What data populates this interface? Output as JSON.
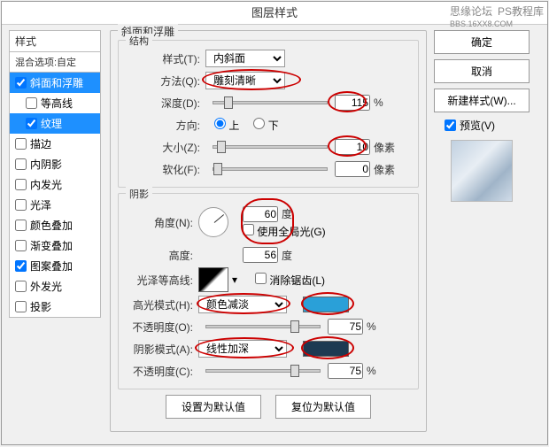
{
  "watermark": {
    "left": "思缘论坛",
    "right": "PS教程库",
    "url": "BBS.16XX8.COM"
  },
  "dialog": {
    "title": "图层样式"
  },
  "left": {
    "header": "样式",
    "sub": "混合选项:自定",
    "items": [
      {
        "label": "斜面和浮雕",
        "checked": true,
        "selected": true
      },
      {
        "label": "等高线",
        "checked": false,
        "sub": true
      },
      {
        "label": "纹理",
        "checked": true,
        "sub": true,
        "selected": true
      },
      {
        "label": "描边",
        "checked": false
      },
      {
        "label": "内阴影",
        "checked": false
      },
      {
        "label": "内发光",
        "checked": false
      },
      {
        "label": "光泽",
        "checked": false
      },
      {
        "label": "颜色叠加",
        "checked": false
      },
      {
        "label": "渐变叠加",
        "checked": false
      },
      {
        "label": "图案叠加",
        "checked": true
      },
      {
        "label": "外发光",
        "checked": false
      },
      {
        "label": "投影",
        "checked": false
      }
    ]
  },
  "bevel": {
    "group_title": "斜面和浮雕",
    "structure_title": "结构",
    "style_label": "样式(T):",
    "style_value": "内斜面",
    "method_label": "方法(Q):",
    "method_value": "雕刻清晰",
    "depth_label": "深度(D):",
    "depth_value": "115",
    "depth_unit": "%",
    "direction_label": "方向:",
    "dir_up": "上",
    "dir_down": "下",
    "size_label": "大小(Z):",
    "size_value": "10",
    "size_unit": "像素",
    "soften_label": "软化(F):",
    "soften_value": "0",
    "soften_unit": "像素"
  },
  "shade": {
    "title": "阴影",
    "angle_label": "角度(N):",
    "angle_value": "60",
    "angle_unit": "度",
    "global_label": "使用全局光(G)",
    "altitude_label": "高度:",
    "altitude_value": "56",
    "altitude_unit": "度",
    "gloss_label": "光泽等高线:",
    "antialias_label": "消除锯齿(L)",
    "hilite_mode_label": "高光模式(H):",
    "hilite_mode_value": "颜色减淡",
    "hilite_color": "#2aa0d8",
    "hilite_opacity_label": "不透明度(O):",
    "hilite_opacity_value": "75",
    "opacity_unit": "%",
    "shadow_mode_label": "阴影模式(A):",
    "shadow_mode_value": "线性加深",
    "shadow_color": "#1d3a52",
    "shadow_opacity_label": "不透明度(C):",
    "shadow_opacity_value": "75"
  },
  "buttons": {
    "default_set": "设置为默认值",
    "default_reset": "复位为默认值",
    "ok": "确定",
    "cancel": "取消",
    "new_style": "新建样式(W)...",
    "preview": "预览(V)"
  }
}
